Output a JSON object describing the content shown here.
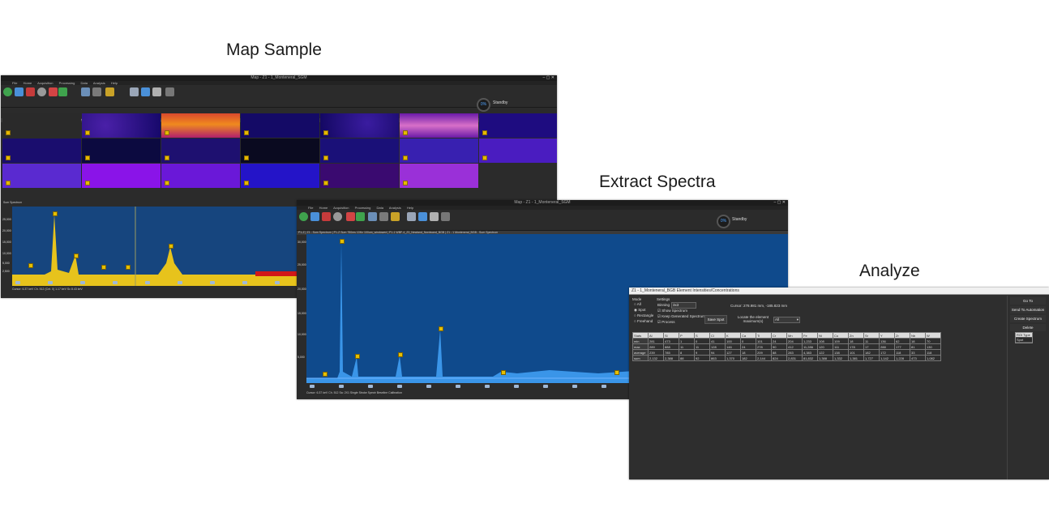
{
  "captions": {
    "map_sample": "Map Sample",
    "extract_spectra": "Extract Spectra",
    "analyze": "Analyze"
  },
  "map_window": {
    "title": "Map - Z1 - 1_Monteneral_SGM",
    "menu": [
      "File",
      "Home",
      "Acquisition",
      "Processing",
      "Data",
      "Analysis",
      "Help"
    ],
    "status": "Standby",
    "percent": "0%",
    "tabs": "P1-Z  |  Z1 - Sum Spectrum  |  P1-Z Sum 750ms 10Hz 100um_windowed  |  P1-1 WBF-4_Z3_Newland_Nordwand_BGB  |  P1-Z1-1_Monteneral_BGB",
    "spectrum_label": "Sum Spectrum",
    "y_ticks": [
      "25,000",
      "20,000",
      "15,000",
      "10,000",
      "5,000",
      "2,500"
    ],
    "status_line": "Cursor: 6.37 keV   Ch. 512 (Cnt. 0)   1.17 keV  Sc 8.43 keV"
  },
  "extract_window": {
    "title": "Map - Z1 - 1_Monteneral_SGM",
    "menu": [
      "File",
      "Home",
      "Acquisition",
      "Processing",
      "Data",
      "Analysis",
      "Help"
    ],
    "status": "Standby",
    "percent": "0%",
    "tabs": "P1-Z  |  Z1 - Sum Spectrum  |  P1-Z Sum 750ms 10Hz 100um_windowed  |  P1-1 WBF-4_Z3_Newland_Nordwand_BGB  |  Z1 - 1 Monteneral_BGB - Sum Spectrum",
    "y_ticks": [
      "30,000",
      "25,000",
      "20,000",
      "15,000",
      "10,000",
      "5,000"
    ],
    "footer": "Cursor: 6.37 keV   Ch. 512   Sa: 2X1   Single Stroke Spectr   Beseline Calibration"
  },
  "analyze_dialog": {
    "title": "Z1 - 1_Monteneral_BGB Element Intensities/Concentrations",
    "mode_label": "Mode",
    "modes": [
      "All",
      "Spot",
      "Rectangle",
      "Freehand"
    ],
    "settings_label": "Settings",
    "binning_label": "Binning",
    "binning_value": "3x3",
    "show_spectrum": "Show Spectrum",
    "keep_generated": "Keep Generated Spectrum",
    "process": "Process",
    "cursor_text": "Cursor: 278.981 mm, -185.823 mm",
    "save_spot": "Save Spot",
    "locate_label": "Locate the element maximum(s)",
    "locate_value": "All",
    "side_buttons": [
      "Go To",
      "Send To Automation",
      "Create Spectrum",
      "Delete"
    ],
    "roi_header": "ROI Type",
    "roi_row": "Spot",
    "table": {
      "headers": [
        "Stats",
        "Al",
        "Si",
        "P",
        "S",
        "Cl",
        "K",
        "Ca",
        "Ti",
        "Cr",
        "Mn",
        "Fe",
        "Ni",
        "Cu",
        "Zn",
        "Sr",
        "Y",
        "Zr",
        "Nb",
        "W"
      ],
      "rows": [
        [
          "min",
          "281",
          "473",
          "1",
          "0",
          "41",
          "100",
          "0",
          "101",
          "24",
          "204",
          "1,233",
          "108",
          "109",
          "18",
          "11",
          "136",
          "62",
          "18",
          "70"
        ],
        [
          "max",
          "289",
          "888",
          "11",
          "11",
          "128",
          "146",
          "24",
          "278",
          "90",
          "412",
          "11,286",
          "120",
          "111",
          "178",
          "17",
          "288",
          "177",
          "81",
          "130"
        ],
        [
          "average",
          "239",
          "785",
          "8",
          "9",
          "94",
          "127",
          "18",
          "209",
          "88",
          "283",
          "4,383",
          "122",
          "138",
          "101",
          "182",
          "172",
          "118",
          "33",
          "118"
        ],
        [
          "sum",
          "2,132",
          "2,388",
          "88",
          "92",
          "863",
          "1,370",
          "182",
          "2,144",
          "824",
          "2,831",
          "81,832",
          "1,388",
          "1,332",
          "1,381",
          "1,727",
          "1,142",
          "1,228",
          "473",
          "1,082"
        ]
      ]
    }
  }
}
